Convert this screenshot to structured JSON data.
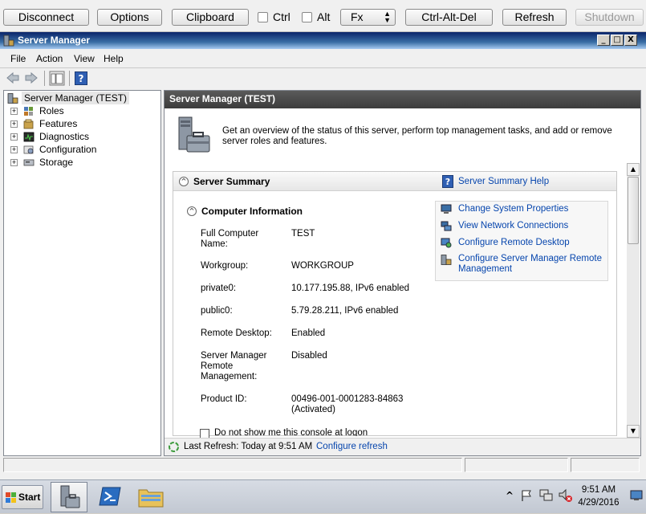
{
  "vnc_bar": {
    "disconnect": "Disconnect",
    "options": "Options",
    "clipboard": "Clipboard",
    "ctrl": "Ctrl",
    "alt": "Alt",
    "fx_select": "Fx",
    "ctrl_alt_del": "Ctrl-Alt-Del",
    "refresh": "Refresh",
    "shutdown": "Shutdown"
  },
  "window": {
    "title": "Server Manager",
    "minimize": "_",
    "maximize": "□",
    "close": "X"
  },
  "menu": [
    "File",
    "Action",
    "View",
    "Help"
  ],
  "tree": {
    "root": "Server Manager (TEST)",
    "items": [
      "Roles",
      "Features",
      "Diagnostics",
      "Configuration",
      "Storage"
    ]
  },
  "main": {
    "header": "Server Manager (TEST)",
    "intro": "Get an overview of the status of this server, perform top management tasks, and add or remove server roles and features.",
    "summary": {
      "title": "Server Summary",
      "help_link": "Server Summary Help"
    },
    "computer_info": {
      "title": "Computer Information",
      "rows": [
        {
          "label": "Full Computer Name:",
          "value": "TEST"
        },
        {
          "label": "Workgroup:",
          "value": "WORKGROUP"
        },
        {
          "label": "private0:",
          "value": "10.177.195.88, IPv6 enabled"
        },
        {
          "label": "public0:",
          "value": "5.79.28.211, IPv6 enabled"
        },
        {
          "label": "Remote Desktop:",
          "value": "Enabled"
        },
        {
          "label": "Server Manager Remote Management:",
          "value": "Disabled"
        },
        {
          "label": "Product ID:",
          "value": "00496-001-0001283-84863 (Activated)"
        }
      ],
      "dont_show": "Do not show me this console at logon"
    },
    "tasks": [
      "Change System Properties",
      "View Network Connections",
      "Configure Remote Desktop",
      "Configure Server Manager Remote Management"
    ],
    "last_refresh": "Last Refresh: Today at 9:51 AM",
    "configure_refresh": "Configure refresh"
  },
  "taskbar": {
    "start": "Start",
    "time": "9:51 AM",
    "date": "4/29/2016",
    "tray_chevron": "^"
  }
}
